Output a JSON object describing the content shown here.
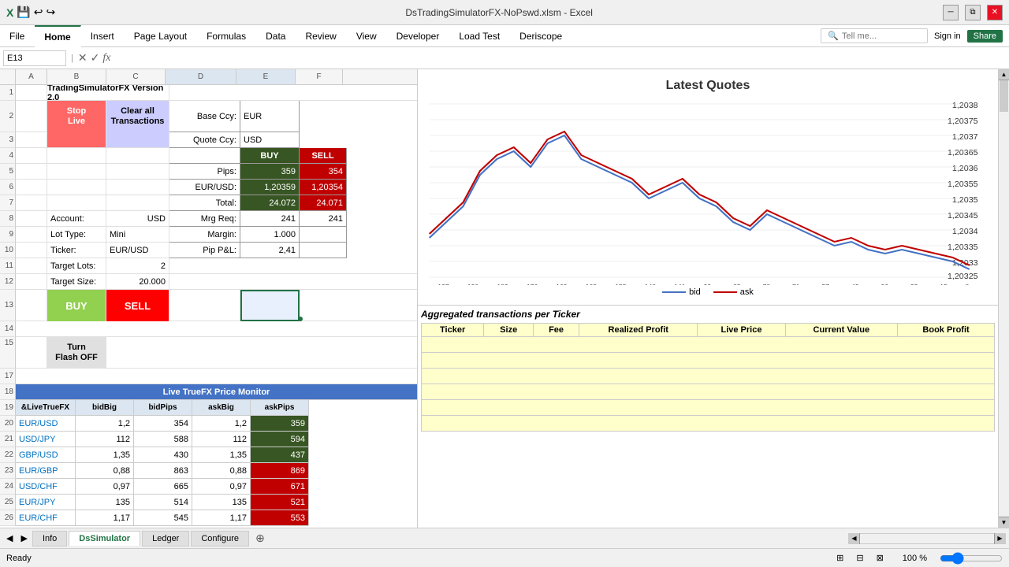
{
  "titleBar": {
    "title": "DsTradingSimulatorFX-NoPswd.xlsm - Excel",
    "saveIcon": "💾",
    "undoIcon": "↩",
    "redoIcon": "↪"
  },
  "ribbon": {
    "tabs": [
      "File",
      "Home",
      "Insert",
      "Page Layout",
      "Formulas",
      "Data",
      "Review",
      "View",
      "Developer",
      "Load Test",
      "Deriscope"
    ],
    "activeTab": "Home",
    "searchPlaceholder": "Tell me...",
    "signIn": "Sign in",
    "share": "Share"
  },
  "formulaBar": {
    "cellRef": "E13",
    "formula": ""
  },
  "spreadsheet": {
    "title": "TradingSimulatorFX Version 2.0",
    "buttons": {
      "stopLive": "Stop\nLive",
      "clearTransactions": "Clear all\nTransactions",
      "buy": "BUY",
      "sell": "SELL",
      "turnFlashOff": "Turn\nFlash OFF"
    },
    "info": {
      "baseCcy": "EUR",
      "quoteCcy": "USD",
      "buyLabel": "BUY",
      "sellLabel": "SELL",
      "pipsLabel": "Pips:",
      "pipsBuy": "359",
      "pipsSell": "354",
      "eurUsdLabel": "EUR/USD:",
      "eurUsdBuy": "1,20359",
      "eurUsdSell": "1,20354",
      "totalLabel": "Total:",
      "totalBuy": "24.072",
      "totalSell": "24.071",
      "mrgReqLabel": "Mrg Req:",
      "mrgReqBuy": "241",
      "mrgReqSell": "241",
      "marginLabel": "Margin:",
      "marginBuy": "1.000",
      "pipPnlLabel": "Pip P&L:",
      "pipPnl": "2,41"
    },
    "account": {
      "label": "Account:",
      "value": "USD",
      "lotTypeLabel": "Lot Type:",
      "lotType": "Mini",
      "tickerLabel": "Ticker:",
      "ticker": "EUR/USD",
      "targetLotsLabel": "Target Lots:",
      "targetLots": "2",
      "targetSizeLabel": "Target Size:",
      "targetSize": "20.000"
    }
  },
  "chart": {
    "title": "Latest Quotes",
    "yAxisValues": [
      "1,2038",
      "1,20375",
      "1,2037",
      "1,20365",
      "1,2036",
      "1,20355",
      "1,2035",
      "1,20345",
      "1,2034",
      "1,20335",
      "1,2033",
      "1,20325"
    ],
    "legend": {
      "bid": "bid",
      "ask": "ask"
    }
  },
  "liveMonitor": {
    "title": "Live TrueFX Price Monitor",
    "headers": [
      "&LiveTrueFX",
      "bidBig",
      "bidPips",
      "askBig",
      "askPips"
    ],
    "rows": [
      {
        "ticker": "EUR/USD",
        "bidBig": "1,2",
        "bidPips": "354",
        "askBig": "1,2",
        "askPips": "359",
        "askHighlight": "green"
      },
      {
        "ticker": "USD/JPY",
        "bidBig": "112",
        "bidPips": "588",
        "askBig": "112",
        "askPips": "594",
        "askHighlight": "green"
      },
      {
        "ticker": "GBP/USD",
        "bidBig": "1,35",
        "bidPips": "430",
        "askBig": "1,35",
        "askPips": "437",
        "askHighlight": "green"
      },
      {
        "ticker": "EUR/GBP",
        "bidBig": "0,88",
        "bidPips": "863",
        "askBig": "0,88",
        "askPips": "869",
        "askHighlight": "red"
      },
      {
        "ticker": "USD/CHF",
        "bidBig": "0,97",
        "bidPips": "665",
        "askBig": "0,97",
        "askPips": "671",
        "askHighlight": "red"
      },
      {
        "ticker": "EUR/JPY",
        "bidBig": "135",
        "bidPips": "514",
        "askBig": "135",
        "askPips": "521",
        "askHighlight": "red"
      },
      {
        "ticker": "EUR/CHF",
        "bidBig": "1,17",
        "bidPips": "545",
        "askBig": "1,17",
        "askPips": "553",
        "askHighlight": "red"
      }
    ]
  },
  "aggregated": {
    "title": "Aggregated transactions per Ticker",
    "headers": [
      "Ticker",
      "Size",
      "Fee",
      "Realized Profit",
      "Live Price",
      "Current Value",
      "Book Profit"
    ]
  },
  "sheetTabs": [
    "Info",
    "DsSimulator",
    "Ledger",
    "Configure"
  ],
  "activeSheet": "DsSimulator",
  "statusBar": {
    "ready": "Ready",
    "zoom": "100 %"
  }
}
